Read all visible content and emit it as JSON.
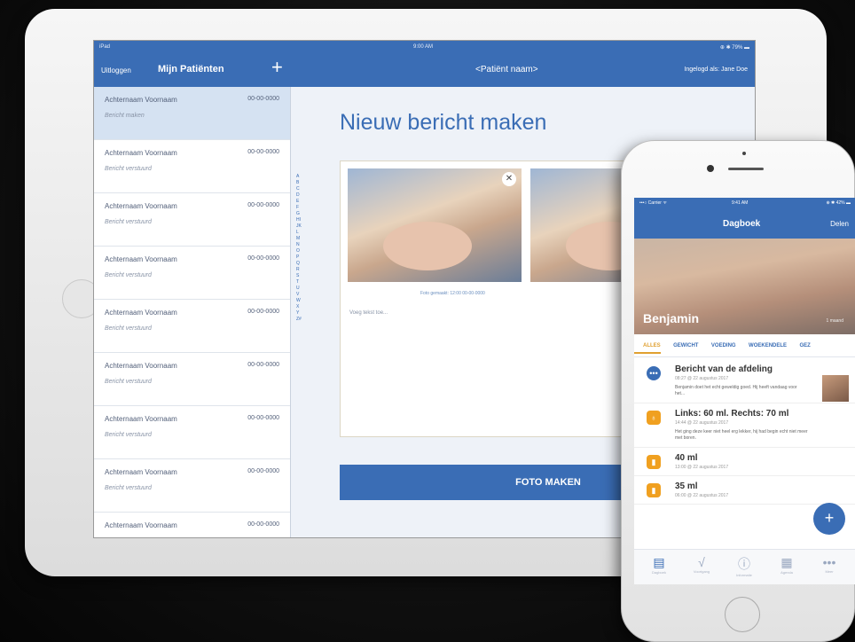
{
  "tablet": {
    "status": {
      "left": "iPad",
      "center": "9:00 AM",
      "right": "⊕ ✱ 79% ▬"
    },
    "nav": {
      "logout": "Uitloggen",
      "title": "Mijn Patiënten",
      "add": "+",
      "patient": "<Patiënt naam>",
      "logged_in": "Ingelogd als: Jane Doe"
    },
    "patients": [
      {
        "name": "Achternaam Voornaam",
        "date": "00-00-0000",
        "sub": "Bericht maken"
      },
      {
        "name": "Achternaam Voornaam",
        "date": "00-00-0000",
        "sub": "Bericht verstuurd"
      },
      {
        "name": "Achternaam Voornaam",
        "date": "00-00-0000",
        "sub": "Bericht verstuurd"
      },
      {
        "name": "Achternaam Voornaam",
        "date": "00-00-0000",
        "sub": "Bericht verstuurd"
      },
      {
        "name": "Achternaam Voornaam",
        "date": "00-00-0000",
        "sub": "Bericht verstuurd"
      },
      {
        "name": "Achternaam Voornaam",
        "date": "00-00-0000",
        "sub": "Bericht verstuurd"
      },
      {
        "name": "Achternaam Voornaam",
        "date": "00-00-0000",
        "sub": "Bericht verstuurd"
      },
      {
        "name": "Achternaam Voornaam",
        "date": "00-00-0000",
        "sub": "Bericht verstuurd"
      },
      {
        "name": "Achternaam Voornaam",
        "date": "00-00-0000",
        "sub": ""
      }
    ],
    "alphabet": "ABCDEFGHIJKLMNOPQRSTUVWXYZ#",
    "main": {
      "title": "Nieuw bericht maken",
      "caption": "Foto gemaakt: 12:00 00-00-0000",
      "placeholder": "Voeg tekst toe...",
      "close": "✕",
      "photo_button": "FOTO MAKEN"
    }
  },
  "phone": {
    "status": {
      "left": "•••○ Carrier ᯤ",
      "center": "9:41 AM",
      "right": "⊕ ✱ 42% ▬"
    },
    "title": "Dagboek",
    "share": "Delen",
    "baby_name": "Benjamin",
    "baby_meta": "1 maand",
    "tabs": [
      "ALLES",
      "GEWICHT",
      "VOEDING",
      "WOEKENDELE",
      "GEZ"
    ],
    "feed": [
      {
        "icon": "•••",
        "title": "Bericht van de afdeling",
        "date": "08:27 @ 22 augustus 2017",
        "body": "Benjamin doet het echt geweldig goed. Hij heeft vandaag voor het...",
        "type": "message"
      },
      {
        "icon": "♁",
        "title": "Links: 60 ml. Rechts: 70 ml",
        "date": "14:44 @ 22 augustus 2017",
        "body": "Het ging deze keer niet heel erg lekker, hij had begin echt niet meer met boren.",
        "type": "feeding"
      },
      {
        "icon": "▮",
        "title": "40 ml",
        "date": "13:00 @ 22 augustus 2017",
        "body": "",
        "type": "bottle"
      },
      {
        "icon": "▮",
        "title": "35 ml",
        "date": "06:00 @ 22 augustus 2017",
        "body": "",
        "type": "bottle"
      }
    ],
    "fab": "+",
    "tabbar": [
      {
        "glyph": "▤",
        "label": "Dagboek"
      },
      {
        "glyph": "√",
        "label": "Voortgang"
      },
      {
        "glyph": "ⓘ",
        "label": "Informatie"
      },
      {
        "glyph": "▦",
        "label": "Agenda"
      },
      {
        "glyph": "•••",
        "label": "Meer"
      }
    ]
  },
  "colors": {
    "brand_blue": "#3a6db5",
    "accent_orange": "#f0a020"
  }
}
